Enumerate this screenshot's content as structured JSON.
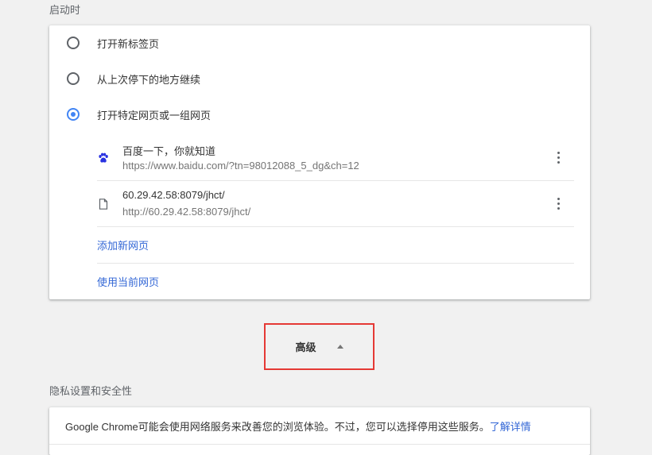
{
  "startup": {
    "section_title": "启动时",
    "options": [
      {
        "label": "打开新标签页",
        "checked": false
      },
      {
        "label": "从上次停下的地方继续",
        "checked": false
      },
      {
        "label": "打开特定网页或一组网页",
        "checked": true
      }
    ],
    "pages": [
      {
        "title": "百度一下，你就知道",
        "url": "https://www.baidu.com/?tn=98012088_5_dg&ch=12",
        "icon": "baidu-paw-icon"
      },
      {
        "title": "60.29.42.58:8079/jhct/",
        "url": "http://60.29.42.58:8079/jhct/",
        "icon": "document-icon"
      }
    ],
    "add_page_label": "添加新网页",
    "use_current_label": "使用当前网页"
  },
  "advanced": {
    "label": "高级"
  },
  "privacy": {
    "section_title": "隐私设置和安全性",
    "description": "Google Chrome可能会使用网络服务来改善您的浏览体验。不过，您可以选择停用这些服务。",
    "learn_more_label": "了解详情"
  },
  "colors": {
    "accent": "#4285f4",
    "link": "#3367d6",
    "highlight_border": "#e53935",
    "background": "#f1f1f1"
  }
}
